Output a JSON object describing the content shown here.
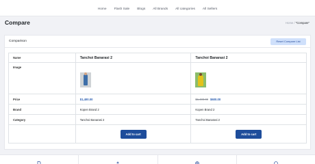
{
  "nav": {
    "links": [
      "Home",
      "Flash Sale",
      "Blogs",
      "All Brands",
      "All categories",
      "All Sellers"
    ]
  },
  "page": {
    "title": "Compare",
    "breadcrumb": {
      "home": "Home",
      "separator": "/",
      "current": "\"Compare\""
    }
  },
  "comparison": {
    "title": "Comparison",
    "reset_label": "Reset Compare List",
    "row_labels": {
      "name": "Name",
      "image": "Image",
      "price": "Price",
      "brand": "Brand",
      "category": "Category"
    },
    "products": [
      {
        "name": "Tanchoi Banarasi 2",
        "price": "$1,400.00",
        "old_price": "",
        "brand": "Kopen Brand 2",
        "category": "Tanchoi Banarasi 2",
        "cart_label": "Add to cart"
      },
      {
        "name": "Tanchoi Banarasi 2",
        "price": "$600.00",
        "old_price": "$1,400.00",
        "brand": "Kopen Brand 2",
        "category": "Tanchoi Banarasi 2",
        "cart_label": "Add to cart"
      }
    ]
  },
  "footer": {
    "icons": [
      "document-icon",
      "upload-icon",
      "globe-icon",
      "help-icon"
    ]
  },
  "colors": {
    "primary": "#1e4d9b",
    "price": "#2a5db0",
    "reset_bg": "#cfe0fb",
    "page_bg": "#f1f2f6"
  }
}
